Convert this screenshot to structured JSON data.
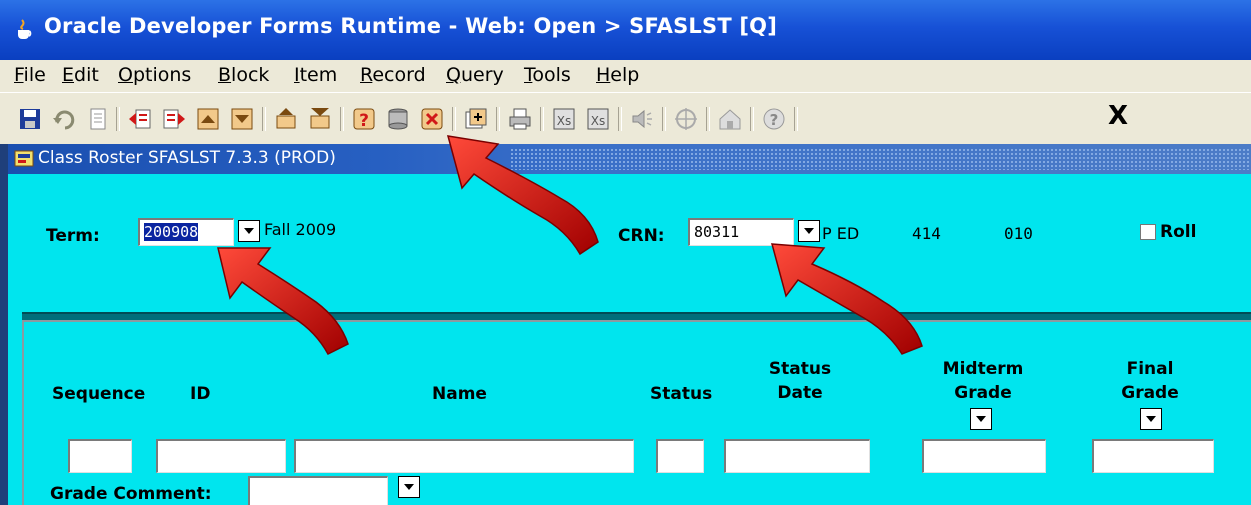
{
  "window": {
    "title": "Oracle Developer Forms Runtime - Web:  Open > SFASLST [Q]"
  },
  "menu": {
    "items": [
      "File",
      "Edit",
      "Options",
      "Block",
      "Item",
      "Record",
      "Query",
      "Tools",
      "Help"
    ]
  },
  "toolbar": {
    "exit_label": "X",
    "icons": [
      "save-icon",
      "rollback-icon",
      "print-icon",
      "previous-block-icon",
      "next-block-icon",
      "previous-record-icon",
      "next-record-icon",
      "enter-query-icon",
      "execute-query-icon",
      "help-icon",
      "list-icon",
      "cancel-query-icon",
      "insert-record-icon",
      "print-screen-icon",
      "remove-record-icon",
      "clear-icon",
      "audio-icon",
      "search-icon",
      "home-icon",
      "help-circle-icon"
    ]
  },
  "form": {
    "title": "Class Roster  SFASLST  7.3.3  (PROD)",
    "term": {
      "label": "Term:",
      "value": "200908",
      "description": "Fall 2009"
    },
    "crn": {
      "label": "CRN:",
      "value": "80311",
      "subject": "P ED",
      "course": "414",
      "section": "010"
    },
    "roll": {
      "label": "Roll"
    },
    "columns": {
      "sequence": "Sequence",
      "id": "ID",
      "name": "Name",
      "status": "Status",
      "status_date": [
        "Status",
        "Date"
      ],
      "midterm_grade": [
        "Midterm",
        "Grade"
      ],
      "final_grade": [
        "Final",
        "Grade"
      ]
    },
    "grade_comment": {
      "label": "Grade Comment:"
    }
  },
  "colors": {
    "form_background": "#00e5ee",
    "title_bar": "#1751d6",
    "arrow": "#e01010"
  }
}
